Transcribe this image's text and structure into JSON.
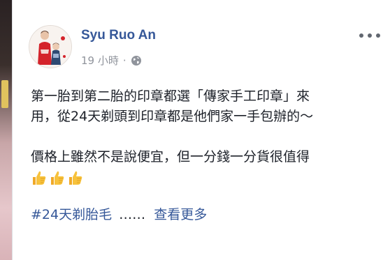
{
  "post": {
    "author": "Syu Ruo An",
    "time": "19 小時",
    "separator": "·",
    "privacy_icon": "globe-icon",
    "text_lines": [
      "第一胎到第二胎的印章都選「傳家手工印章」來",
      "用，從24天剃頭到印章都是他們家一手包辦的～",
      "",
      "價格上雖然不是說便宜，但一分錢一分貨很值得"
    ],
    "emoji": [
      "thumbs-up-icon",
      "thumbs-up-icon",
      "thumbs-up-icon"
    ],
    "hashtag": "#24天剃胎毛",
    "ellipsis": "……",
    "see_more": "查看更多"
  },
  "colors": {
    "link": "#365899",
    "text": "#1d2129",
    "meta": "#90949c",
    "emoji": "#f7c23c"
  }
}
